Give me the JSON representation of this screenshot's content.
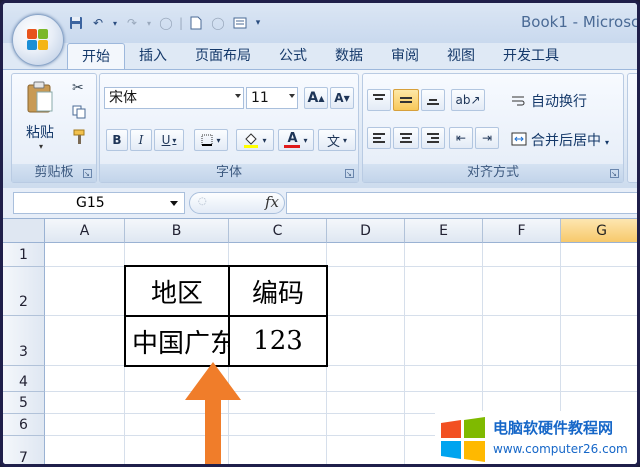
{
  "window": {
    "title": "Book1 - Microsc"
  },
  "tabs": [
    "开始",
    "插入",
    "页面布局",
    "公式",
    "数据",
    "审阅",
    "视图",
    "开发工具"
  ],
  "ribbon": {
    "clipboard": {
      "paste": "粘贴",
      "label": "剪贴板"
    },
    "font": {
      "name": "宋体",
      "size": "11",
      "grow": "A",
      "shrink": "A",
      "bold": "B",
      "italic": "I",
      "underline": "U",
      "phonetic": "文",
      "label": "字体"
    },
    "alignment": {
      "wrap": "自动换行",
      "merge": "合并后居中",
      "label": "对齐方式"
    }
  },
  "formula_bar": {
    "name_box": "G15",
    "fx": "fx",
    "value": ""
  },
  "grid": {
    "columns": [
      "A",
      "B",
      "C",
      "D",
      "E",
      "F",
      "G"
    ],
    "selected_column": "G",
    "rows": [
      "1",
      "2",
      "3",
      "4",
      "5",
      "6",
      "7"
    ],
    "cells": {
      "B2": "地区",
      "C2": "编码",
      "B3": "中国广东",
      "C3": "123"
    }
  },
  "watermark": {
    "title": "电脑软硬件教程网",
    "url": "www.computer26.com"
  },
  "colors": {
    "arrow": "#f07d2a",
    "selected_header": "#f7c96b",
    "ribbon_text": "#15396a"
  }
}
